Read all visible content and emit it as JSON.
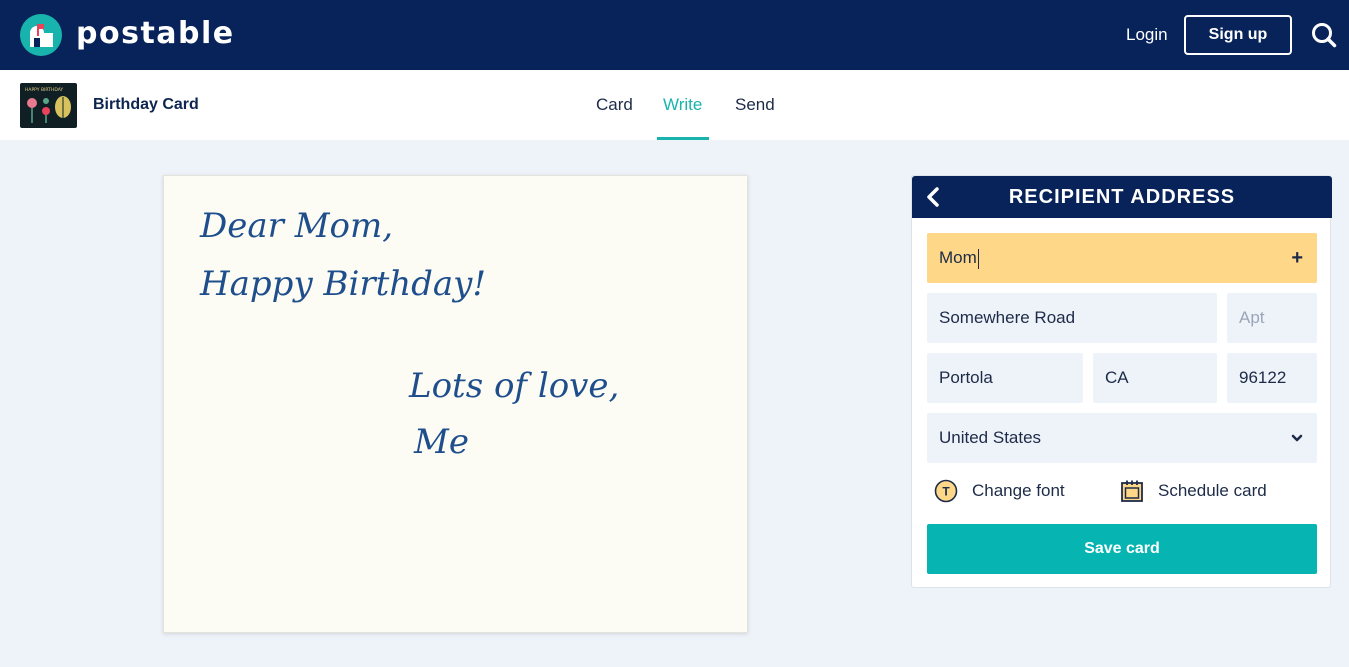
{
  "brand": {
    "name": "postable",
    "logo_icon": "mailbox-logo-icon"
  },
  "nav": {
    "login_label": "Login",
    "signup_label": "Sign up",
    "search_icon": "search-icon"
  },
  "subheader": {
    "card_title": "Birthday Card",
    "thumbnail_text": "HAPPY BIRTHDAY",
    "tabs": [
      {
        "label": "Card",
        "active": false
      },
      {
        "label": "Write",
        "active": true
      },
      {
        "label": "Send",
        "active": false
      }
    ]
  },
  "card": {
    "lines": [
      "Dear Mom,",
      "Happy Birthday!",
      "Lots of love,",
      "Me"
    ]
  },
  "recipient": {
    "title": "RECIPIENT ADDRESS",
    "back_icon": "chevron-left-icon",
    "name_value": "Mom",
    "add_icon": "+",
    "street_value": "Somewhere Road",
    "apt_placeholder": "Apt",
    "city_value": "Portola",
    "state_value": "CA",
    "zip_value": "96122",
    "country_value": "United States",
    "change_font_label": "Change font",
    "schedule_label": "Schedule card",
    "save_label": "Save card"
  },
  "colors": {
    "navy": "#08235a",
    "teal": "#06b5b2",
    "highlight_field": "#fed888",
    "field_bg": "#eef3f9",
    "paper": "#fcfcf4",
    "ink": "#1f4e8c"
  }
}
